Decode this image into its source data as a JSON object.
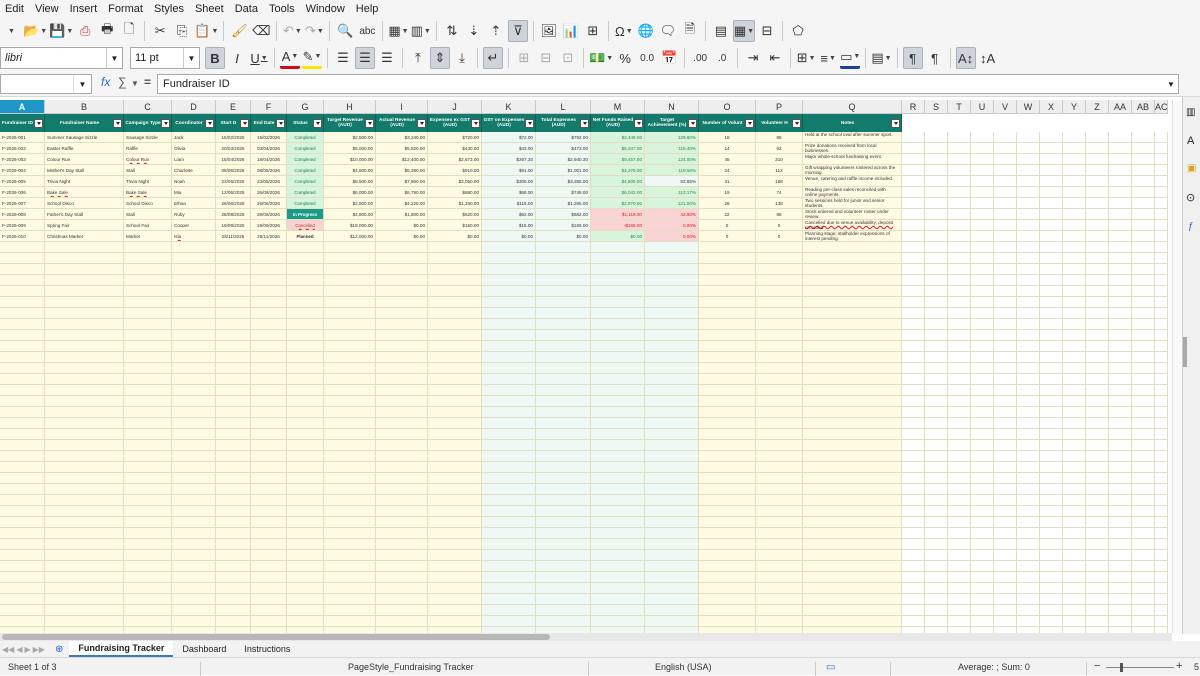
{
  "menu": [
    "Edit",
    "View",
    "Insert",
    "Format",
    "Styles",
    "Sheet",
    "Data",
    "Tools",
    "Window",
    "Help"
  ],
  "font": {
    "name": "libri",
    "size": "11 pt"
  },
  "formula": {
    "name_box": "",
    "fx": "fx",
    "sigma": "∑",
    "eq": "=",
    "content": "Fundraiser ID"
  },
  "columns": [
    {
      "letter": "A",
      "w": 45,
      "header": "Fundraiser ID"
    },
    {
      "letter": "B",
      "w": 79,
      "header": "Fundraiser Name"
    },
    {
      "letter": "C",
      "w": 48,
      "header": "Campaign Type"
    },
    {
      "letter": "D",
      "w": 44,
      "header": "Coordinator"
    },
    {
      "letter": "E",
      "w": 35,
      "header": "Start D"
    },
    {
      "letter": "F",
      "w": 36,
      "header": "End Date"
    },
    {
      "letter": "G",
      "w": 37,
      "header": "Status"
    },
    {
      "letter": "H",
      "w": 52,
      "header": "Target Revenue (AUD)"
    },
    {
      "letter": "I",
      "w": 52,
      "header": "Actual Revenue (AUD)"
    },
    {
      "letter": "J",
      "w": 54,
      "header": "Expenses ex GST (AUD)"
    },
    {
      "letter": "K",
      "w": 54,
      "header": "GST on Expenses (AUD)"
    },
    {
      "letter": "L",
      "w": 55,
      "header": "Total Expenses (AUD)"
    },
    {
      "letter": "M",
      "w": 54,
      "header": "Net Funds Raised (AUD)"
    },
    {
      "letter": "N",
      "w": 54,
      "header": "Target Achievement (%)"
    },
    {
      "letter": "O",
      "w": 57,
      "header": "Number of Volunt"
    },
    {
      "letter": "P",
      "w": 47,
      "header": "Volunteer H"
    },
    {
      "letter": "Q",
      "w": 99,
      "header": "Notes"
    },
    {
      "letter": "R",
      "w": 23,
      "header": ""
    },
    {
      "letter": "S",
      "w": 23,
      "header": ""
    },
    {
      "letter": "T",
      "w": 23,
      "header": ""
    },
    {
      "letter": "U",
      "w": 23,
      "header": ""
    },
    {
      "letter": "V",
      "w": 23,
      "header": ""
    },
    {
      "letter": "W",
      "w": 23,
      "header": ""
    },
    {
      "letter": "X",
      "w": 23,
      "header": ""
    },
    {
      "letter": "Y",
      "w": 23,
      "header": ""
    },
    {
      "letter": "Z",
      "w": 23,
      "header": ""
    },
    {
      "letter": "AA",
      "w": 23,
      "header": ""
    },
    {
      "letter": "AB",
      "w": 23,
      "header": ""
    },
    {
      "letter": "AC",
      "w": 13,
      "header": ""
    }
  ],
  "rows": [
    [
      "F-2026-001",
      "Summer Sausage Sizzle",
      "Sausage Sizzle",
      "Jack",
      "15/02/2026",
      "15/02/2026",
      "Completed",
      "$2,500.00",
      "$3,240.00",
      "$720.00",
      "$72.00",
      "$792.00",
      "$2,448.00",
      "129.60%",
      "18",
      "86",
      "Held at the school oval after summer sport."
    ],
    [
      "F-2026-002",
      "Easter Raffle",
      "Raffle",
      "Olivia",
      "20/03/2026",
      "03/04/2026",
      "Completed",
      "$5,000.00",
      "$5,820.00",
      "$430.00",
      "$43.00",
      "$473.00",
      "$5,347.00",
      "116.40%",
      "14",
      "62",
      "Prize donations received from local businesses."
    ],
    [
      "F-2026-003",
      "Colour Run",
      "Colour Run",
      "Liam",
      "18/04/2026",
      "18/04/2026",
      "Completed",
      "$10,000.00",
      "$12,400.00",
      "$2,673.00",
      "$267.30",
      "$2,940.30",
      "$9,457.00",
      "124.00%",
      "45",
      "310",
      "Major whole-school fundraising event."
    ],
    [
      "F-2026-004",
      "Mother's Day Stall",
      "Stall",
      "Charlotte",
      "08/05/2026",
      "08/05/2026",
      "Completed",
      "$4,500.00",
      "$5,380.00",
      "$910.00",
      "$91.00",
      "$1,001.00",
      "$4,379.00",
      "119.56%",
      "24",
      "112",
      "Gift wrapping volunteers rostered across the morning."
    ],
    [
      "F-2026-005",
      "Trivia Night",
      "Trivia Night",
      "Noah",
      "23/05/2026",
      "23/05/2026",
      "Completed",
      "$8,500.00",
      "$7,960.00",
      "$3,050.00",
      "$305.00",
      "$3,355.00",
      "$4,605.00",
      "93.65%",
      "31",
      "188",
      "Venue, catering and raffle income included."
    ],
    [
      "F-2026-006",
      "Bake Sale",
      "Bake Sale",
      "Mia",
      "12/06/2026",
      "26/06/2026",
      "Completed",
      "$6,000.00",
      "$6,790.00",
      "$680.00",
      "$68.00",
      "$748.00",
      "$6,042.00",
      "113.17%",
      "19",
      "74",
      "Reading per-class sales reconciled with online payments."
    ],
    [
      "F-2026-007",
      "School Disco",
      "School Disco",
      "Ethan",
      "26/06/2026",
      "26/06/2026",
      "Completed",
      "$2,500.00",
      "$4,225.00",
      "$1,150.00",
      "$115.00",
      "$1,265.00",
      "$2,970.00",
      "121.00%",
      "28",
      "138",
      "Two sessions held for junior and senior students."
    ],
    [
      "F-2026-008",
      "Father's Day Stall",
      "Stall",
      "Ruby",
      "28/08/2026",
      "28/08/2026",
      "In Progress",
      "$4,800.00",
      "$1,800.00",
      "$620.00",
      "$62.00",
      "$682.00",
      "$1,118.00",
      "43.50%",
      "22",
      "86",
      "Stock ordered and volunteer roster under review."
    ],
    [
      "F-2026-009",
      "Spring Fair",
      "School Fair",
      "Cooper",
      "19/09/2026",
      "19/09/2026",
      "Cancelled",
      "$18,000.00",
      "$0.00",
      "$150.00",
      "$15.00",
      "$165.00",
      "-$165.00",
      "0.00%",
      "0",
      "0",
      "Cancelled due to venue availability; deposit recorded."
    ],
    [
      "F-2026-010",
      "Christmas Market",
      "Market",
      "Isla",
      "28/11/2026",
      "28/11/2026",
      "Planned",
      "$12,000.00",
      "$0.00",
      "$0.00",
      "$0.00",
      "$0.00",
      "$0.00",
      "0.00%",
      "0",
      "0",
      "Planning stage; stallholder expressions of interest pending."
    ]
  ],
  "sheet_tabs": [
    "Fundraising Tracker",
    "Dashboard",
    "Instructions"
  ],
  "status": {
    "sheet": "Sheet 1 of 3",
    "style": "PageStyle_Fundraising Tracker",
    "lang": "English (USA)",
    "sum": "Average: ; Sum: 0",
    "zoom": "5"
  },
  "colors": {
    "header_green": "#127b6c",
    "row_yellow": "#fffbe3",
    "row_mint": "#eef9f5",
    "status_green": "#d6f5df",
    "status_progress": "#1a9b88",
    "status_red": "#f9d3d3",
    "net_green": "#d8f4dc",
    "net_red": "#fad4d4",
    "net_green_text": "#2a8a3c",
    "net_red_text": "#d02020"
  }
}
